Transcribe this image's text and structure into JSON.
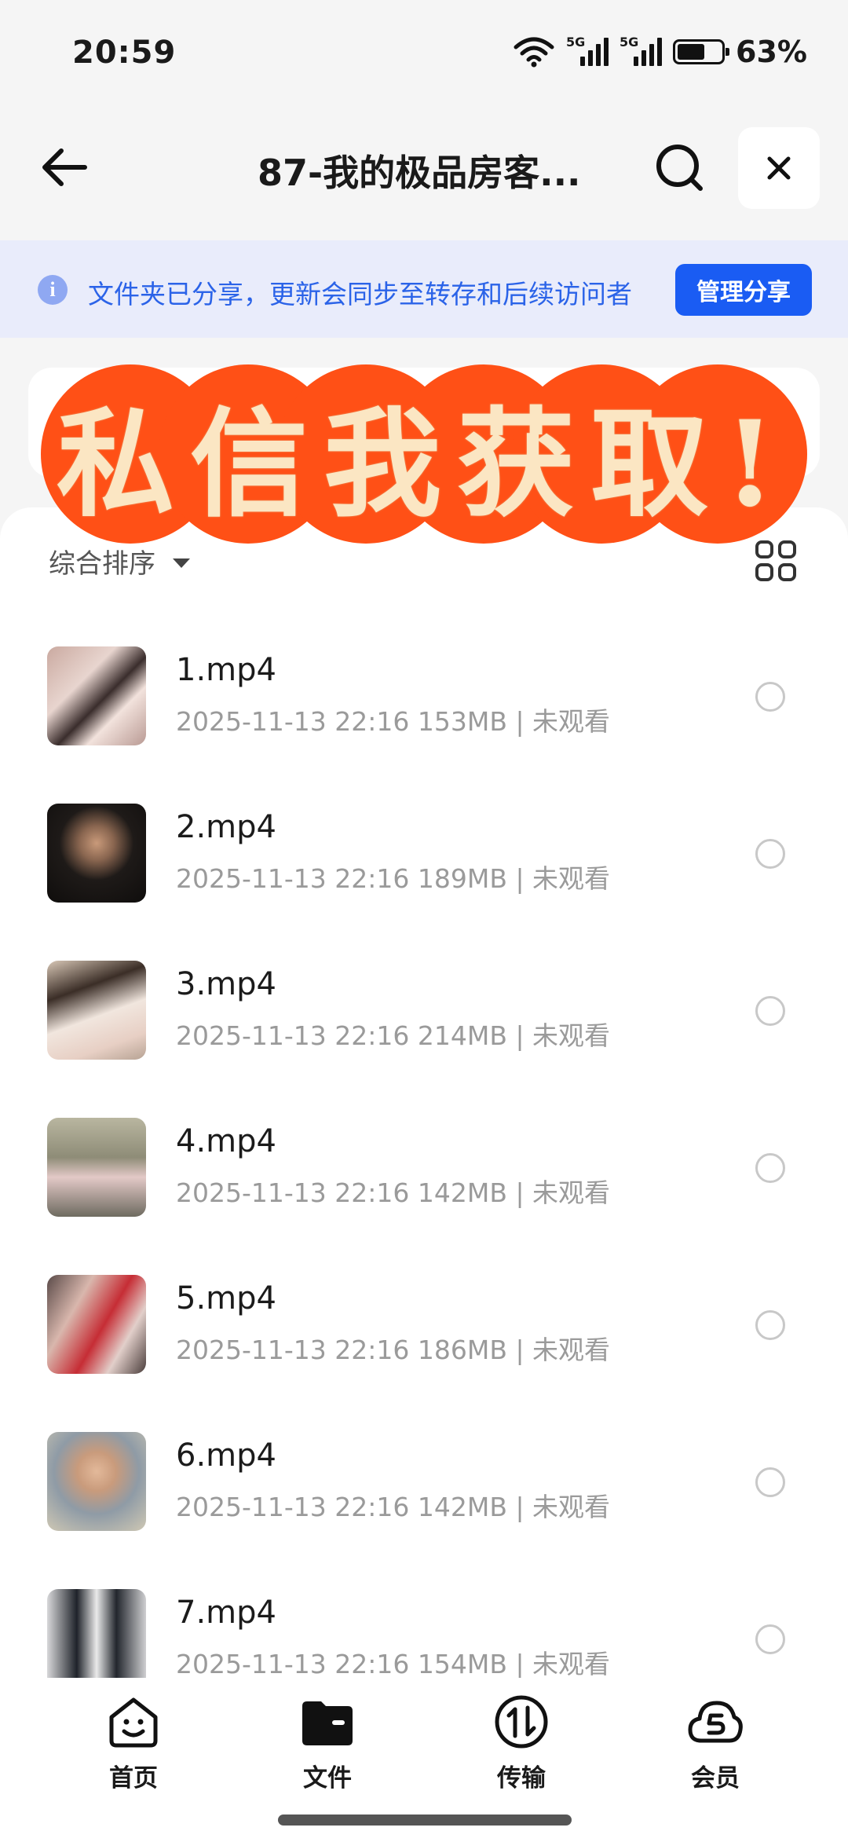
{
  "status_bar": {
    "time": "20:59",
    "network_1": "5G",
    "network_2": "5G",
    "battery_percent": "63%",
    "battery_level": 0.63
  },
  "nav": {
    "title": "87-我的极品房客...",
    "back_icon": "arrow-left-icon",
    "search_icon": "search-icon",
    "close_icon": "close-icon"
  },
  "share_banner": {
    "text": "文件夹已分享，更新会同步至转存和后续访问者",
    "button_label": "管理分享",
    "icon": "info-icon",
    "accent": "#1a5cf3"
  },
  "promo": {
    "text": "私信我获取!",
    "bg_color": "#ff5016",
    "text_color": "#fbe6c3"
  },
  "toolbar": {
    "sort_label": "综合排序",
    "view_icon": "grid-view-icon"
  },
  "files": [
    {
      "name": "1.mp4",
      "meta": "2025-11-13 22:16  153MB | 未观看"
    },
    {
      "name": "2.mp4",
      "meta": "2025-11-13 22:16  189MB | 未观看"
    },
    {
      "name": "3.mp4",
      "meta": "2025-11-13 22:16  214MB | 未观看"
    },
    {
      "name": "4.mp4",
      "meta": "2025-11-13 22:16  142MB | 未观看"
    },
    {
      "name": "5.mp4",
      "meta": "2025-11-13 22:16  186MB | 未观看"
    },
    {
      "name": "6.mp4",
      "meta": "2025-11-13 22:16  142MB | 未观看"
    },
    {
      "name": "7.mp4",
      "meta": "2025-11-13 22:16  154MB | 未观看"
    }
  ],
  "tabs": [
    {
      "label": "首页",
      "icon": "home-smile-icon"
    },
    {
      "label": "文件",
      "icon": "folder-icon"
    },
    {
      "label": "传输",
      "icon": "transfer-icon"
    },
    {
      "label": "会员",
      "icon": "vip-cloud-icon"
    }
  ]
}
